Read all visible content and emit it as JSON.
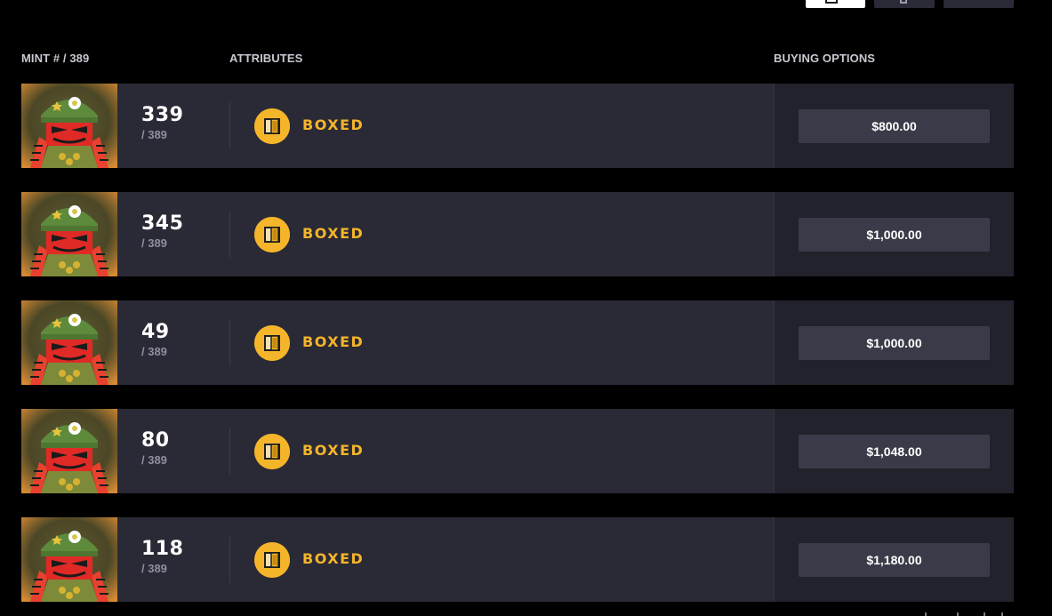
{
  "header": {
    "mint": "MINT # / 389",
    "attributes": "ATTRIBUTES",
    "buying_options": "BUYING OPTIONS"
  },
  "listings": [
    {
      "mint": "339",
      "total": "/ 389",
      "attribute": "BOXED",
      "price": "$800.00"
    },
    {
      "mint": "345",
      "total": "/ 389",
      "attribute": "BOXED",
      "price": "$1,000.00"
    },
    {
      "mint": "49",
      "total": "/ 389",
      "attribute": "BOXED",
      "price": "$1,000.00"
    },
    {
      "mint": "80",
      "total": "/ 389",
      "attribute": "BOXED",
      "price": "$1,048.00"
    },
    {
      "mint": "118",
      "total": "/ 389",
      "attribute": "BOXED",
      "price": "$1,180.00"
    }
  ],
  "icons": {
    "toolbar": [
      "list-view-icon",
      "sort-icon",
      "filter-icon"
    ],
    "attribute": "box-icon"
  },
  "colors": {
    "background": "#000000",
    "row": "#2a2a36",
    "buy_panel": "#21222b",
    "price_button": "#3a3b48",
    "accent": "#f5b52a"
  }
}
